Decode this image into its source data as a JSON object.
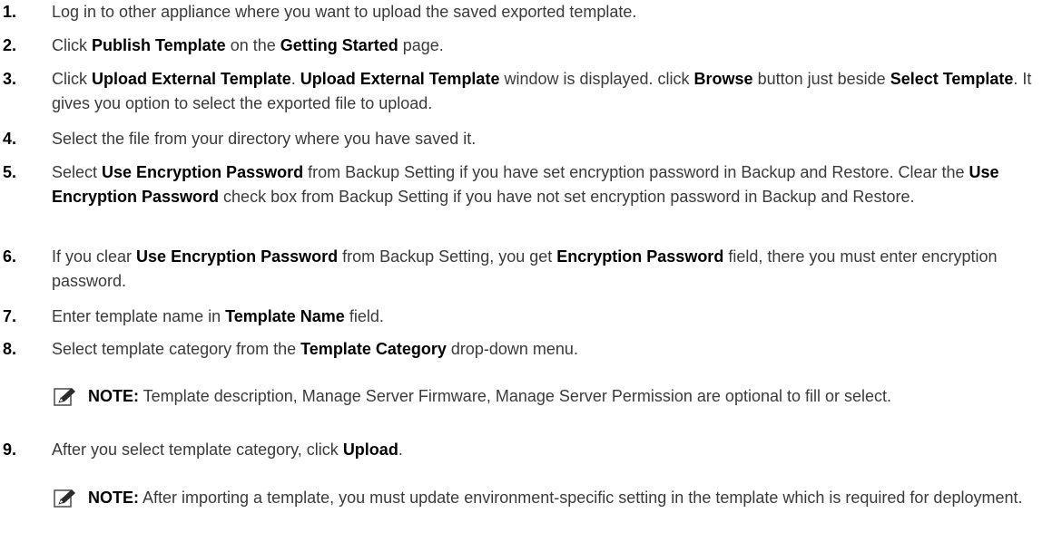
{
  "steps": [
    {
      "num": "1.",
      "parts": [
        {
          "t": "Log in to other appliance where you want to upload the saved exported template.",
          "b": false
        }
      ]
    },
    {
      "num": "2.",
      "parts": [
        {
          "t": "Click ",
          "b": false
        },
        {
          "t": "Publish Template",
          "b": true
        },
        {
          "t": " on the ",
          "b": false
        },
        {
          "t": "Getting Started",
          "b": true
        },
        {
          "t": " page.",
          "b": false
        }
      ]
    },
    {
      "num": "3.",
      "parts": [
        {
          "t": "Click ",
          "b": false
        },
        {
          "t": "Upload External Template",
          "b": true
        },
        {
          "t": ". ",
          "b": false
        },
        {
          "t": "Upload External Template",
          "b": true
        },
        {
          "t": " window is displayed. click ",
          "b": false
        },
        {
          "t": "Browse",
          "b": true
        },
        {
          "t": " button just beside ",
          "b": false
        },
        {
          "t": "Select Template",
          "b": true
        },
        {
          "t": ". It gives you option to select the exported file to upload.",
          "b": false
        }
      ]
    },
    {
      "num": "4.",
      "parts": [
        {
          "t": "Select the file from your directory where you have saved it.",
          "b": false
        }
      ]
    },
    {
      "num": "5.",
      "parts": [
        {
          "t": "Select ",
          "b": false
        },
        {
          "t": "Use Encryption Password",
          "b": true
        },
        {
          "t": " from Backup Setting if you have set encryption password in Backup and Restore. Clear the ",
          "b": false
        },
        {
          "t": "Use Encryption Password",
          "b": true
        },
        {
          "t": " check box from Backup Setting if you have not set encryption password in Backup and Restore.",
          "b": false
        }
      ]
    },
    {
      "num": "6.",
      "parts": [
        {
          "t": "If you clear ",
          "b": false
        },
        {
          "t": "Use Encryption Password",
          "b": true
        },
        {
          "t": " from Backup Setting, you get ",
          "b": false
        },
        {
          "t": "Encryption Password",
          "b": true
        },
        {
          "t": " field, there you must enter encryption password.",
          "b": false
        }
      ]
    },
    {
      "num": "7.",
      "parts": [
        {
          "t": "Enter template name in ",
          "b": false
        },
        {
          "t": "Template Name",
          "b": true
        },
        {
          "t": " field.",
          "b": false
        }
      ]
    },
    {
      "num": "8.",
      "parts": [
        {
          "t": "Select template category from the ",
          "b": false
        },
        {
          "t": "Template Category",
          "b": true
        },
        {
          "t": " drop-down menu.",
          "b": false
        }
      ]
    },
    {
      "num": "9.",
      "parts": [
        {
          "t": "After you select template category, click ",
          "b": false
        },
        {
          "t": "Upload",
          "b": true
        },
        {
          "t": ".",
          "b": false
        }
      ]
    }
  ],
  "notes": [
    {
      "label": "NOTE:",
      "text": " Template description, Manage Server Firmware, Manage Server Permission are optional to fill or select."
    },
    {
      "label": "NOTE:",
      "text": " After importing a template, you must update environment-specific setting in the template which is required for deployment."
    }
  ],
  "icons": {
    "note": "note-pencil-icon"
  },
  "colors": {
    "text": "#3a3a3a",
    "bold": "#000000"
  }
}
